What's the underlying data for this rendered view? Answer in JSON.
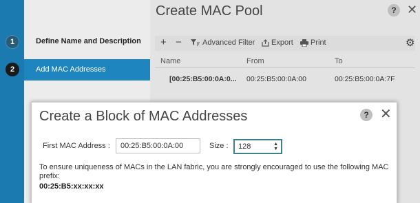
{
  "wizard": {
    "steps": [
      {
        "number": "1",
        "label": "Define Name and Description"
      },
      {
        "number": "2",
        "label": "Add MAC Addresses"
      }
    ]
  },
  "pool": {
    "title": "Create MAC Pool",
    "help": "?",
    "close": "✕",
    "toolbar": {
      "add": "+",
      "remove": "−",
      "filter_label": "Advanced Filter",
      "export_label": "Export",
      "print_label": "Print"
    },
    "table": {
      "columns": [
        "Name",
        "From",
        "To"
      ],
      "rows": [
        {
          "name": "[00:25:B5:00:0A:0...",
          "from": "00:25:B5:00:0A:00",
          "to": "00:25:B5:00:0A:7F"
        }
      ]
    }
  },
  "dialog": {
    "title": "Create a Block of MAC Addresses",
    "help": "?",
    "close": "✕",
    "first_label": "First MAC Address :",
    "first_value": "00:25:B5:00:0A:00",
    "size_label": "Size :",
    "size_value": "128",
    "note": "To ensure uniqueness of MACs in the LAN fabric, you are strongly encouraged to use the following MAC prefix:",
    "prefix": "00:25:B5:xx:xx:xx"
  },
  "icons": {
    "filter": "filter-icon",
    "export": "export-icon",
    "print": "print-icon",
    "settings": "gear-icon"
  }
}
